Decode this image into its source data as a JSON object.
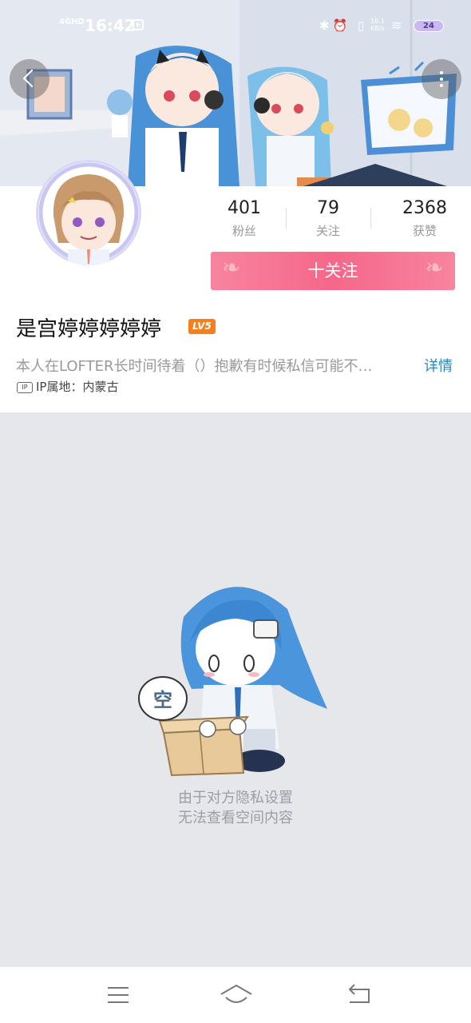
{
  "status_bar": {
    "network": "4GHD",
    "time": "16:42",
    "icons_text": "✱⏰ ▯",
    "speed_value": "18.1",
    "speed_unit": "KB/s",
    "wifi": "≋",
    "battery": "24"
  },
  "profile": {
    "stats": [
      {
        "value": "401",
        "label": "粉丝"
      },
      {
        "value": "79",
        "label": "关注"
      },
      {
        "value": "2368",
        "label": "获赞"
      }
    ],
    "follow_label": "十关注",
    "name": "是宫婷婷婷婷婷",
    "level": "LV5",
    "bio": "本人在LOFTER长时间待着（）抱歉有时候私信可能不…",
    "detail_label": "详情",
    "ip_badge": "IP",
    "ip_location": "IP属地：内蒙古"
  },
  "empty_state": {
    "bubble_text": "空",
    "line1": "由于对方隐私设置",
    "line2": "无法查看空间内容"
  },
  "icons": [
    "back-arrow-icon",
    "more-vertical-icon",
    "menu-icon",
    "home-icon",
    "return-icon"
  ],
  "colors": {
    "accent_pink": "#f6678a",
    "link_blue": "#2f86b5",
    "level_orange": "#f3801d"
  }
}
